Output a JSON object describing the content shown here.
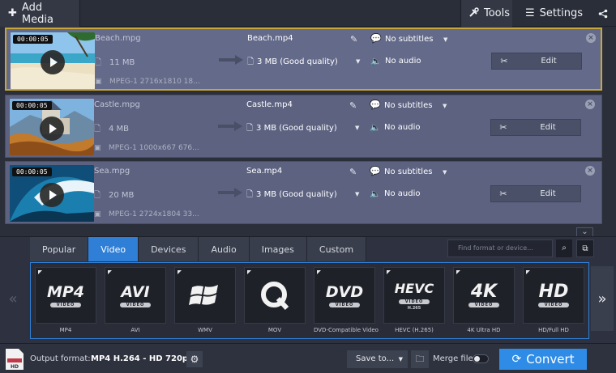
{
  "toolbar": {
    "add_media": "Add Media",
    "tools": "Tools",
    "settings": "Settings"
  },
  "files": [
    {
      "duration": "00:00:05",
      "source_name": "Beach.mpg",
      "source_size": "11 MB",
      "source_codec": "MPEG-1 2716x1810 18...",
      "output_name": "Beach.mp4",
      "output_quality": "3 MB (Good quality)",
      "subtitles": "No subtitles",
      "audio": "No audio",
      "edit_label": "Edit",
      "thumb": "beach"
    },
    {
      "duration": "00:00:05",
      "source_name": "Castle.mpg",
      "source_size": "4 MB",
      "source_codec": "MPEG-1 1000x667 676...",
      "output_name": "Castle.mp4",
      "output_quality": "3 MB (Good quality)",
      "subtitles": "No subtitles",
      "audio": "No audio",
      "edit_label": "Edit",
      "thumb": "castle"
    },
    {
      "duration": "00:00:05",
      "source_name": "Sea.mpg",
      "source_size": "20 MB",
      "source_codec": "MPEG-1 2724x1804 33...",
      "output_name": "Sea.mp4",
      "output_quality": "3 MB (Good quality)",
      "subtitles": "No subtitles",
      "audio": "No audio",
      "edit_label": "Edit",
      "thumb": "sea"
    }
  ],
  "format_tabs": [
    "Popular",
    "Video",
    "Devices",
    "Audio",
    "Images",
    "Custom"
  ],
  "active_tab": "Video",
  "search": {
    "placeholder": "Find format or device..."
  },
  "formats": [
    {
      "big": "MP4",
      "sub": "VIDEO",
      "caption": "MP4"
    },
    {
      "big": "AVI",
      "sub": "VIDEO",
      "caption": "AVI"
    },
    {
      "big": "",
      "sub": "",
      "caption": "WMV"
    },
    {
      "big": "Q",
      "sub": "",
      "caption": "MOV"
    },
    {
      "big": "DVD",
      "sub": "VIDEO",
      "caption": "DVD-Compatible Video"
    },
    {
      "big": "HEVC",
      "sub": "VIDEO",
      "subline": "H.265",
      "caption": "HEVC (H.265)"
    },
    {
      "big": "4K",
      "sub": "VIDEO",
      "caption": "4K Ultra HD"
    },
    {
      "big": "HD",
      "sub": "VIDEO",
      "caption": "HD/Full HD"
    }
  ],
  "bottom": {
    "output_format_label": "Output format:",
    "output_format_value": "MP4 H.264 - HD 720p",
    "output_icon_text": "HD",
    "save_to": "Save to...",
    "merge_files": "Merge files",
    "convert": "Convert"
  },
  "colors": {
    "accent": "#2f8ce6",
    "active_tab": "#2f7fd6",
    "selected_border": "#c9a63a",
    "row_bg": "#5c6280"
  }
}
